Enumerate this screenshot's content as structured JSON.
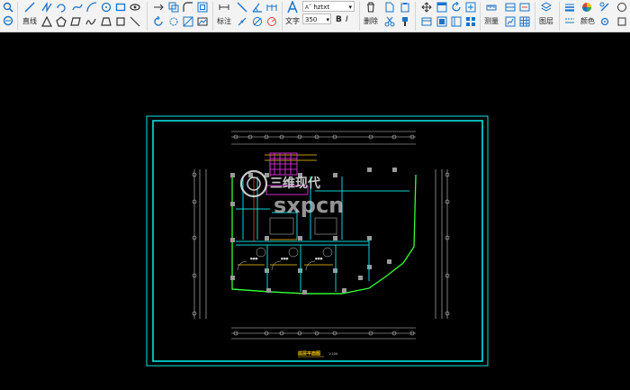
{
  "toolbar": {
    "draw_label": "直线",
    "dim_label": "标注",
    "text_label": "文字",
    "font_value": "hztxt",
    "size_value": "350",
    "bold_label": "B",
    "italic_label": "I",
    "delete_label": "删除",
    "measure_label": "测量",
    "layer_label": "图层",
    "color_label": "颜色",
    "font_prefix": "A˚"
  },
  "drawing": {
    "title": "底层平面图",
    "scale": "1:100",
    "watermark_cn": "三维现代",
    "watermark_en": "sxpcn"
  },
  "colors": {
    "frame": "#00e5e5",
    "wall_outline": "#33ff33",
    "magenta": "#ff33ff",
    "title_yellow": "#ffcc00"
  }
}
